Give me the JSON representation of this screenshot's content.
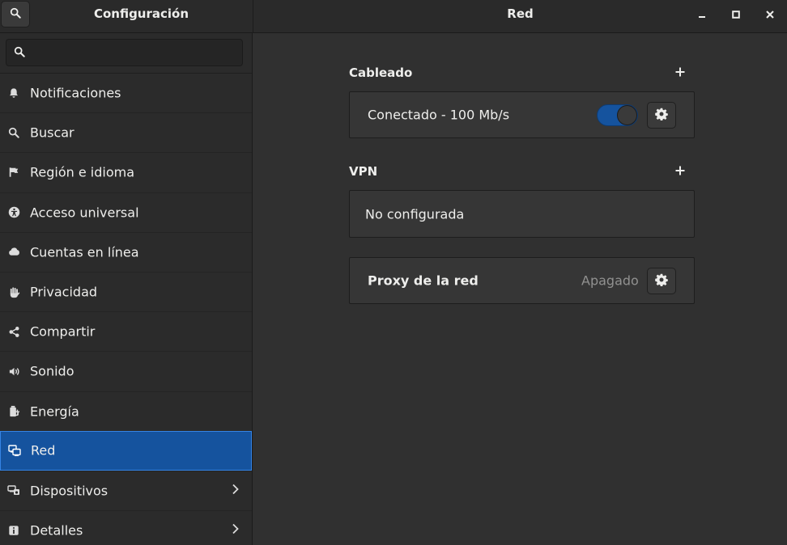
{
  "header": {
    "left_title": "Configuración",
    "main_title": "Red"
  },
  "sidebar": {
    "search": {
      "value": "",
      "placeholder": ""
    },
    "items": [
      {
        "label": "Notificaciones",
        "icon": "bell-icon"
      },
      {
        "label": "Buscar",
        "icon": "search-icon"
      },
      {
        "label": "Región e idioma",
        "icon": "flag-icon"
      },
      {
        "label": "Acceso universal",
        "icon": "accessibility-icon"
      },
      {
        "label": "Cuentas en línea",
        "icon": "cloud-icon"
      },
      {
        "label": "Privacidad",
        "icon": "hand-icon"
      },
      {
        "label": "Compartir",
        "icon": "share-icon"
      },
      {
        "label": "Sonido",
        "icon": "speaker-icon"
      },
      {
        "label": "Energía",
        "icon": "battery-plug-icon"
      },
      {
        "label": "Red",
        "icon": "network-icon",
        "active": true
      },
      {
        "label": "Dispositivos",
        "icon": "devices-icon",
        "submenu": true
      },
      {
        "label": "Detalles",
        "icon": "info-icon",
        "submenu": true
      }
    ]
  },
  "main": {
    "wired": {
      "title": "Cableado",
      "status": "Conectado - 100 Mb/s",
      "enabled": true
    },
    "vpn": {
      "title": "VPN",
      "status": "No configurada"
    },
    "proxy": {
      "label": "Proxy de la red",
      "status": "Apagado"
    }
  },
  "colors": {
    "accent": "#15539e",
    "accent_border": "#3584e4",
    "background": "#303030",
    "sidebar": "#2b2b2b",
    "panel": "#363636"
  }
}
